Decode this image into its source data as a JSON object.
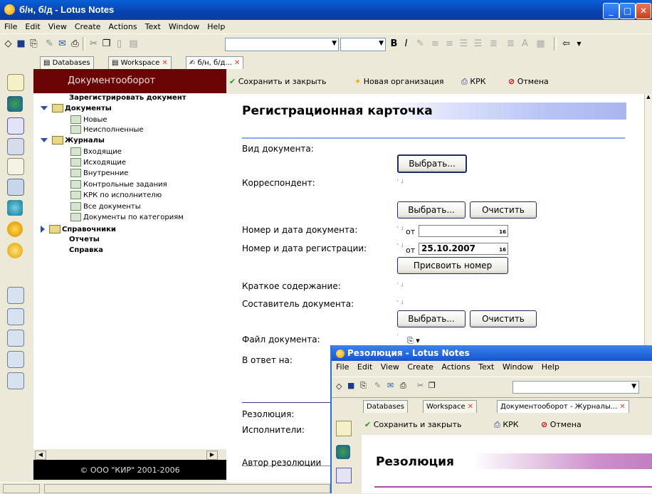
{
  "window": {
    "title": "б/н, б/д - Lotus Notes"
  },
  "menu": [
    "File",
    "Edit",
    "View",
    "Create",
    "Actions",
    "Text",
    "Window",
    "Help"
  ],
  "toolbar": {
    "bold": "B",
    "italic": "I"
  },
  "tabs": [
    {
      "label": "Databases"
    },
    {
      "label": "Workspace"
    },
    {
      "label": "б/н, б/д..."
    }
  ],
  "nav": {
    "header": "Документооборот",
    "items": [
      {
        "label": "Зарегистрировать документ"
      },
      {
        "label": "Документы"
      },
      {
        "label": "Новые"
      },
      {
        "label": "Неисполненные"
      },
      {
        "label": "Журналы"
      },
      {
        "label": "Входящие"
      },
      {
        "label": "Исходящие"
      },
      {
        "label": "Внутренние"
      },
      {
        "label": "Контрольные задания"
      },
      {
        "label": "КРК по исполнителю"
      },
      {
        "label": "Все документы"
      },
      {
        "label": "Документы по категориям"
      },
      {
        "label": "Справочники"
      },
      {
        "label": "Отчеты"
      },
      {
        "label": "Справка"
      }
    ],
    "footer": "© ООО \"КИР\" 2001-2006"
  },
  "actions": {
    "save_close": "Сохранить и закрыть",
    "new_org": "Новая организация",
    "krk": "КРК",
    "cancel": "Отмена"
  },
  "form": {
    "title": "Регистрационная карточка",
    "doc_type_label": "Вид документа:",
    "choose": "Выбрать...",
    "clear": "Очистить",
    "correspondent_label": "Корреспондент:",
    "doc_number_label": "Номер и дата документа:",
    "from": "от",
    "reg_number_label": "Номер и дата регистрации:",
    "reg_date": "25.10.2007",
    "assign_number": "Присвоить номер",
    "summary_label": "Краткое содержание:",
    "author_label": "Составитель документа:",
    "file_label": "Файл документа:",
    "reply_label": "В ответ на:",
    "resolution_label": "Резолюция:",
    "executors_label": "Исполнители:",
    "resolution_author_label": "Автор резолюции"
  },
  "popup": {
    "title": "Резолюция - Lotus Notes",
    "menu": [
      "File",
      "Edit",
      "View",
      "Create",
      "Actions",
      "Text",
      "Window",
      "Help"
    ],
    "tabs": [
      "Databases",
      "Workspace",
      "Документооборот - Журналы..."
    ],
    "save_close": "Сохранить и закрыть",
    "krk": "КРК",
    "cancel": "Отмена",
    "heading": "Резолюция"
  }
}
